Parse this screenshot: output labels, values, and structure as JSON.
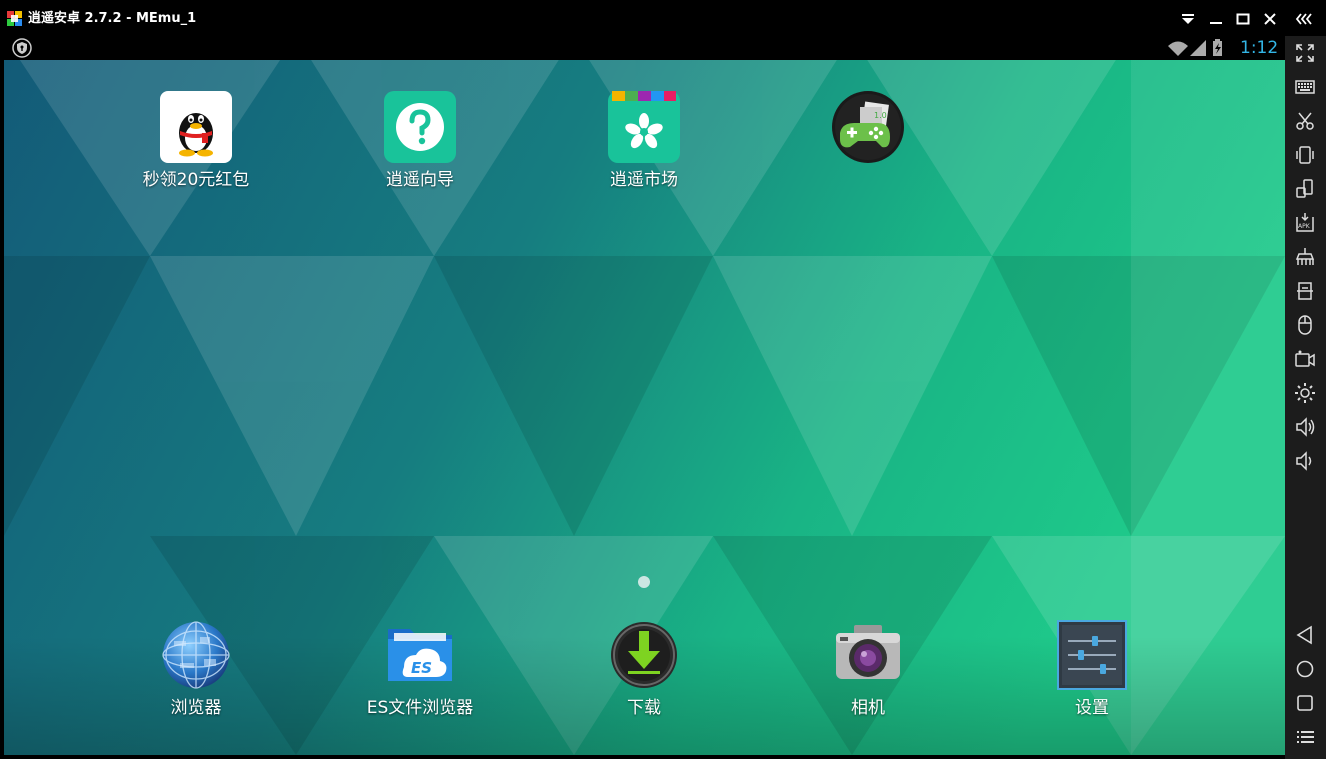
{
  "window": {
    "title": "逍遥安卓 2.7.2 - MEmu_1",
    "controls": [
      "dropdown-icon",
      "minimize-icon",
      "maximize-icon",
      "close-icon"
    ],
    "collapse_icon": "double-chevron-left-icon"
  },
  "statusbar": {
    "time": "1:12",
    "time_color": "#33b5e5",
    "icons": [
      "shield-icon",
      "wifi-icon",
      "signal-icon",
      "battery-charging-icon"
    ]
  },
  "home": {
    "apps": [
      {
        "label": "秒领20元红包",
        "icon": "qq-penguin-icon"
      },
      {
        "label": "逍遥向导",
        "icon": "help-question-icon"
      },
      {
        "label": "逍遥市场",
        "icon": "market-bag-icon"
      },
      {
        "label": "",
        "icon": "game-controller-icon"
      }
    ],
    "dock": [
      {
        "label": "浏览器",
        "icon": "globe-browser-icon"
      },
      {
        "label": "ES文件浏览器",
        "icon": "es-folder-icon"
      },
      {
        "label": "下载",
        "icon": "download-arrow-icon"
      },
      {
        "label": "相机",
        "icon": "camera-icon"
      },
      {
        "label": "设置",
        "icon": "settings-sliders-icon"
      }
    ]
  },
  "toolbar": {
    "tools": [
      "fullscreen-icon",
      "keyboard-icon",
      "scissors-icon",
      "shake-icon",
      "rotate-icon",
      "apk-install-icon",
      "clean-icon",
      "screen-capture-icon",
      "mouse-icon",
      "video-record-icon",
      "settings-gear-icon",
      "volume-up-icon",
      "volume-down-icon"
    ],
    "nav": [
      "back-icon",
      "home-icon",
      "recent-apps-icon",
      "menu-icon"
    ]
  },
  "colors": {
    "wallpaper_dark": "#135a78",
    "wallpaper_light": "#1ec98a",
    "toolbar_bg": "#1c1c1c",
    "icon_green": "#19c39a"
  }
}
